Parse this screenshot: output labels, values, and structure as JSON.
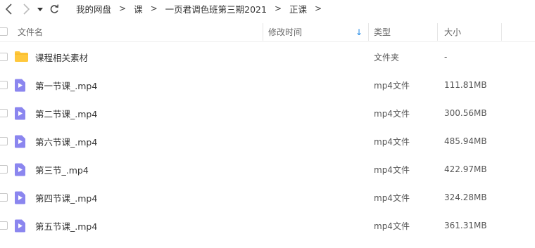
{
  "breadcrumb": {
    "items": [
      "我的网盘",
      "课",
      "一页君调色班第三期2021",
      "正课"
    ],
    "trailing_separator": ">"
  },
  "nav": {
    "back_icon": "chevron-left-icon",
    "forward_icon": "chevron-right-icon",
    "history_icon": "triangle-down-icon",
    "refresh_icon": "refresh-icon"
  },
  "columns": {
    "name": "文件名",
    "modified": "修改时间",
    "type": "类型",
    "size": "大小",
    "sort_indicator": "↓"
  },
  "colors": {
    "folder": "#ffc83d",
    "video": "#8b86ef",
    "sort_accent": "#1e88e5"
  },
  "files": [
    {
      "name": "课程相关素材",
      "type": "文件夹",
      "size": "-",
      "icon": "folder-icon"
    },
    {
      "name": "第一节课_.mp4",
      "type": "mp4文件",
      "size": "111.81MB",
      "icon": "video-file-icon"
    },
    {
      "name": "第二节课_.mp4",
      "type": "mp4文件",
      "size": "300.56MB",
      "icon": "video-file-icon"
    },
    {
      "name": "第六节课_.mp4",
      "type": "mp4文件",
      "size": "485.94MB",
      "icon": "video-file-icon"
    },
    {
      "name": "第三节_.mp4",
      "type": "mp4文件",
      "size": "422.97MB",
      "icon": "video-file-icon"
    },
    {
      "name": "第四节课_.mp4",
      "type": "mp4文件",
      "size": "324.28MB",
      "icon": "video-file-icon"
    },
    {
      "name": "第五节课_.mp4",
      "type": "mp4文件",
      "size": "361.31MB",
      "icon": "video-file-icon"
    }
  ]
}
